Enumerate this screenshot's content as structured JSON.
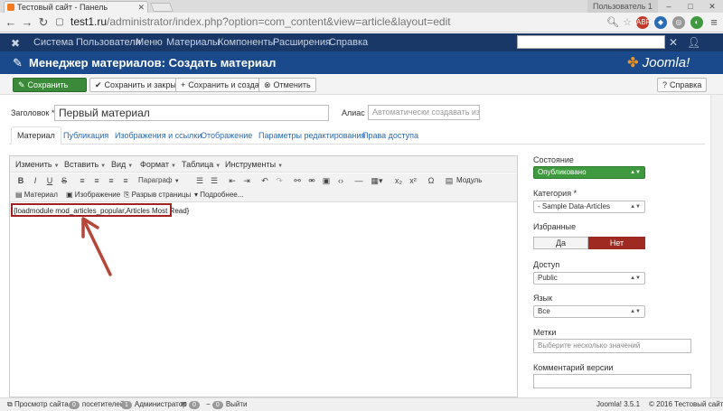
{
  "browser": {
    "tab_title": "Тестовый сайт - Панель",
    "user_label": "Пользователь 1",
    "url_host": "test1.ru",
    "url_path": "/administrator/index.php?option=com_content&view=article&layout=edit"
  },
  "admin_nav": {
    "items": [
      "Система",
      "Пользователи",
      "Меню",
      "Материалы",
      "Компоненты",
      "Расширения",
      "Справка"
    ]
  },
  "title_bar": {
    "title": "Менеджер материалов: Создать материал",
    "logo_text": "Joomla!"
  },
  "toolbar": {
    "save": "Сохранить",
    "save_close": "Сохранить и закрыть",
    "save_new": "Сохранить и создать",
    "cancel": "Отменить",
    "help": "Справка"
  },
  "form": {
    "title_label": "Заголовок *",
    "title_value": "Первый материал",
    "alias_label": "Алиас",
    "alias_placeholder": "Автоматически создавать из загол"
  },
  "tabs": [
    "Материал",
    "Публикация",
    "Изображения и ссылки",
    "Отображение",
    "Параметры редактирования",
    "Права доступа"
  ],
  "editor": {
    "menu": [
      "Изменить",
      "Вставить",
      "Вид",
      "Формат",
      "Таблица",
      "Инструменты"
    ],
    "format_select": "Параграф",
    "module_btn": "Модуль",
    "row2": [
      "Материал",
      "Изображение",
      "Разрыв страницы",
      "Подробнее..."
    ],
    "content": "{loadmodule mod_articles_popular,Articles Most Read}"
  },
  "sidebar": {
    "state_label": "Состояние",
    "state_value": "Опубликовано",
    "category_label": "Категория *",
    "category_value": "- Sample Data-Articles",
    "featured_label": "Избранные",
    "featured_yes": "Да",
    "featured_no": "Нет",
    "access_label": "Доступ",
    "access_value": "Public",
    "language_label": "Язык",
    "language_value": "Все",
    "tags_label": "Метки",
    "tags_placeholder": "Выберите несколько значений",
    "version_label": "Комментарий версии"
  },
  "status_bar": {
    "view_site": "Просмотр сайта",
    "visitors_count": "0",
    "visitors": "посетителей",
    "admins_count": "1",
    "admins": "Администратор",
    "messages_count": "0",
    "logout_count": "0",
    "logout": "Выйти",
    "version": "Joomla! 3.5.1",
    "copyright": "© 2016 Тестовый сайт"
  },
  "colors": {
    "admin_nav_bg": "#1a3867",
    "title_bar_bg": "#1b4a8c",
    "save_green": "#3a8a3a",
    "featured_no_red": "#9e2a22",
    "highlight_red": "#a52020"
  }
}
